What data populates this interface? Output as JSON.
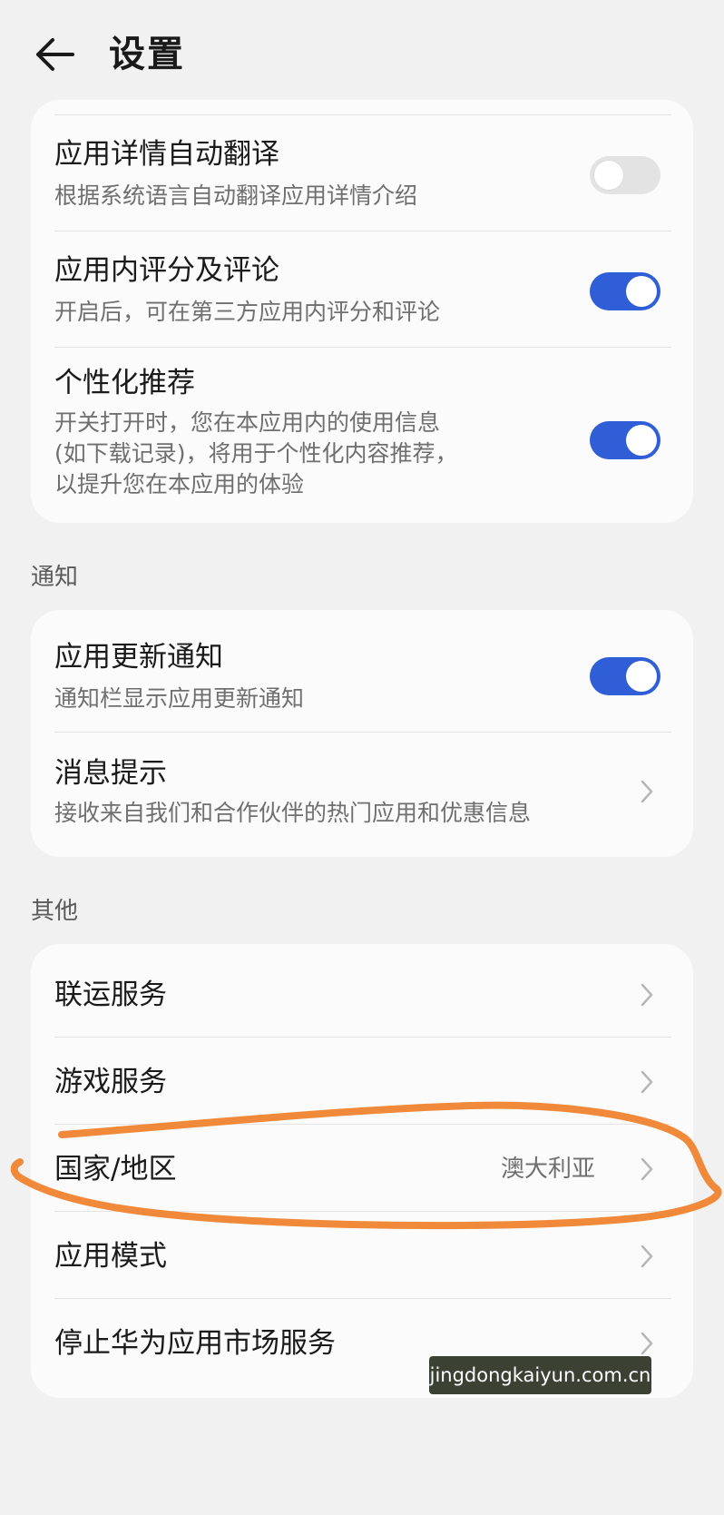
{
  "header": {
    "title": "设置",
    "back_icon": "arrow-left-icon"
  },
  "card1": {
    "items": [
      {
        "title": "应用详情自动翻译",
        "desc": "根据系统语言自动翻译应用详情介绍",
        "toggle": false
      },
      {
        "title": "应用内评分及评论",
        "desc": "开启后，可在第三方应用内评分和评论",
        "toggle": true
      },
      {
        "title": "个性化推荐",
        "desc_lines": [
          "开关打开时，您在本应用内的使用信息",
          "(如下载记录)，将用于个性化内容推荐，",
          "以提升您在本应用的体验"
        ],
        "toggle": true
      }
    ]
  },
  "section_notify": "通知",
  "card2": {
    "items": [
      {
        "title": "应用更新通知",
        "desc": "通知栏显示应用更新通知",
        "toggle": true
      },
      {
        "title": "消息提示",
        "desc": "接收来自我们和合作伙伴的热门应用和优惠信息"
      }
    ]
  },
  "section_other": "其他",
  "card3": {
    "items": [
      {
        "title": "联运服务"
      },
      {
        "title": "游戏服务"
      },
      {
        "title": "国家/地区",
        "value": "澳大利亚"
      },
      {
        "title": "应用模式"
      },
      {
        "title": "停止华为应用市场服务"
      }
    ]
  },
  "watermark": "jingdongkaiyun.com.cn",
  "colors": {
    "background": "#f2f1f1",
    "card": "#fbfbfb",
    "toggle_on": "#2f5ed6",
    "toggle_off": "#e3e3e3",
    "annotation": "#f08a3a"
  }
}
